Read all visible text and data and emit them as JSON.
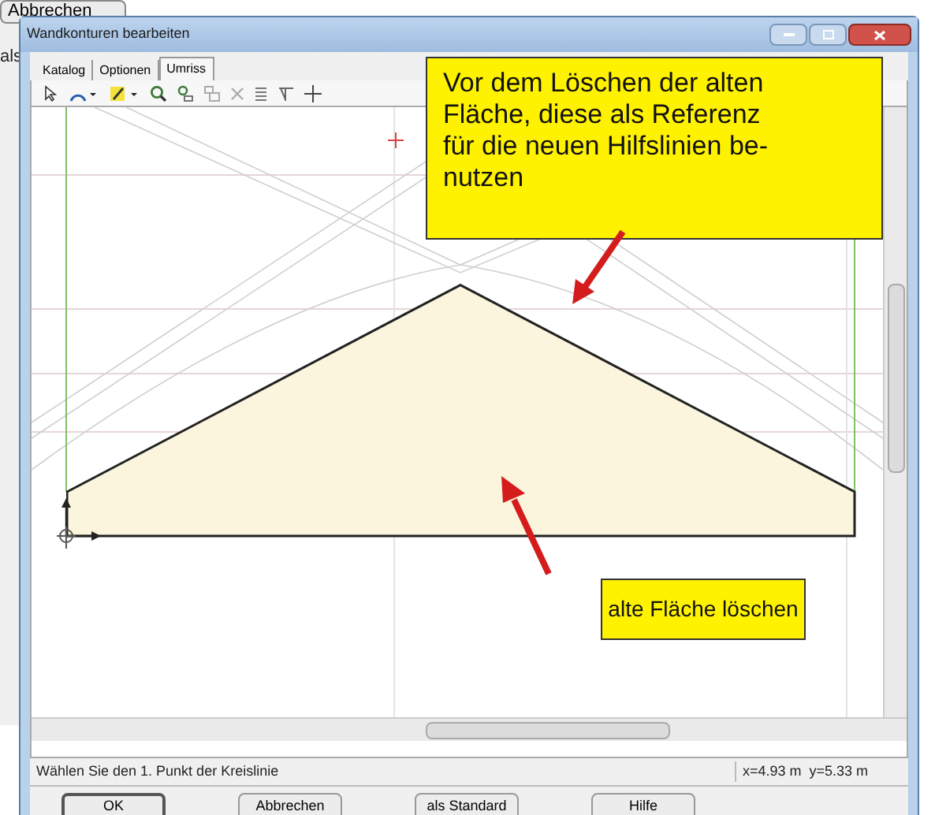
{
  "background_window": {
    "button": "Abbrechen",
    "label_fragment": "als"
  },
  "window": {
    "title": "Wandkonturen bearbeiten"
  },
  "tabs": [
    {
      "label": "Katalog",
      "selected": false
    },
    {
      "label": "Optionen",
      "selected": false
    },
    {
      "label": "Umriss",
      "selected": true
    }
  ],
  "status_bar": {
    "message": "Wählen Sie den 1. Punkt der Kreislinie",
    "coordinates": "x=4.93 m  y=5.33 m"
  },
  "buttons": [
    {
      "label": "OK",
      "default": true
    },
    {
      "label": "Abbrechen",
      "default": false
    },
    {
      "label": "als Standard",
      "default": false
    },
    {
      "label": "Hilfe",
      "default": false
    }
  ],
  "annotations": [
    {
      "lines": [
        "Vor dem Löschen der alten",
        "Fläche, diese als Referenz",
        "für die neuen Hilfslinien be-",
        "nutzen"
      ]
    },
    {
      "lines": [
        "alte Fläche löschen"
      ]
    }
  ]
}
